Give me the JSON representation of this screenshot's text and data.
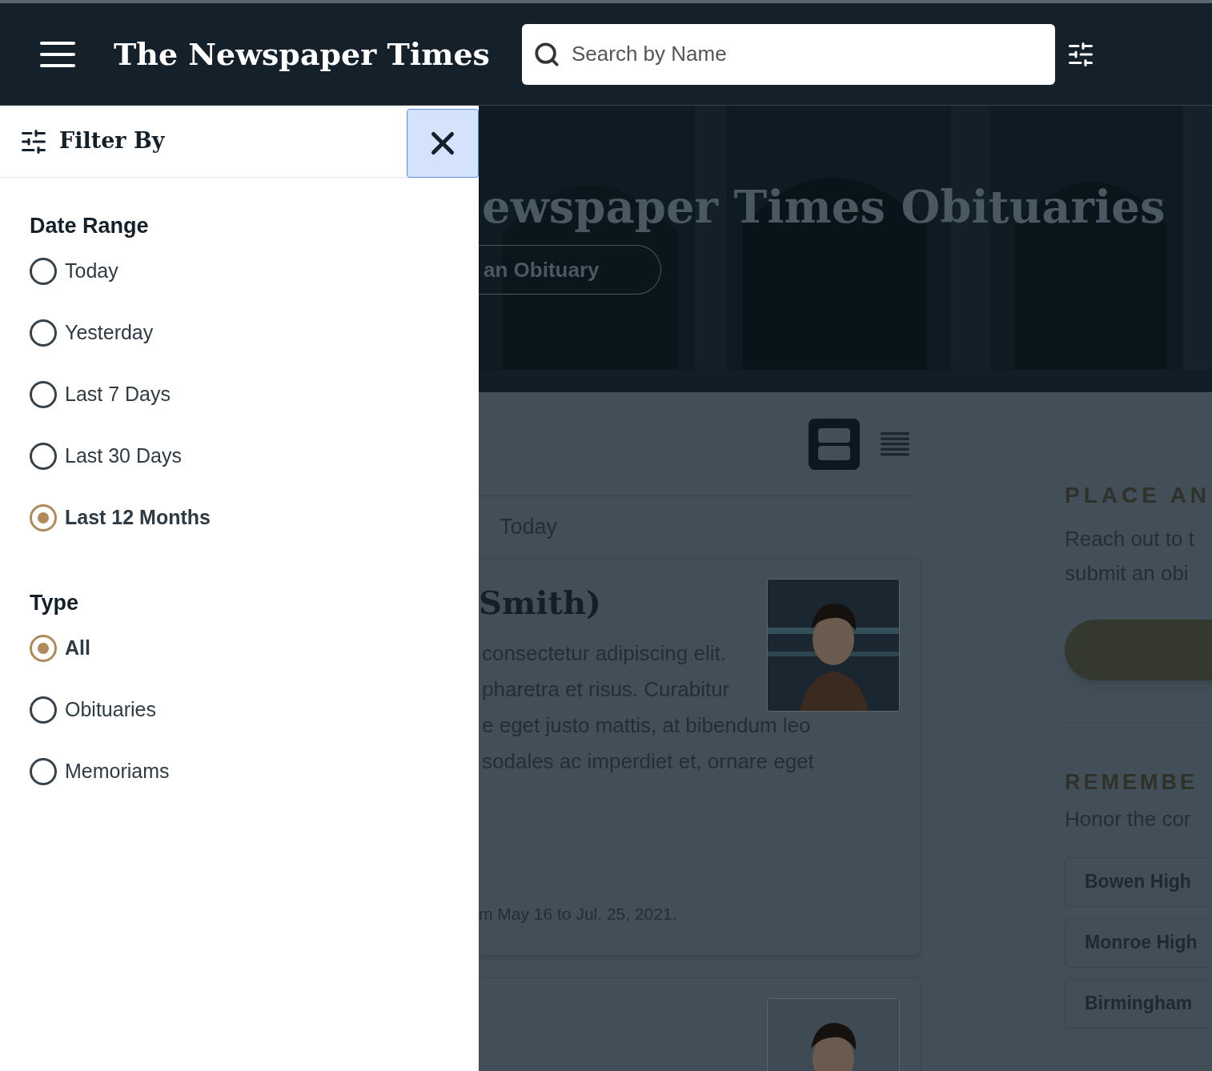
{
  "header": {
    "logo": "The Newspaper Times",
    "search": {
      "placeholder": "Search by Name"
    }
  },
  "filter_panel": {
    "title": "Filter By",
    "groups": [
      {
        "title": "Date Range",
        "options": [
          {
            "label": "Today",
            "selected": false
          },
          {
            "label": "Yesterday",
            "selected": false
          },
          {
            "label": "Last 7 Days",
            "selected": false
          },
          {
            "label": "Last 30 Days",
            "selected": false
          },
          {
            "label": "Last 12 Months",
            "selected": true
          }
        ]
      },
      {
        "title": "Type",
        "options": [
          {
            "label": "All",
            "selected": true
          },
          {
            "label": "Obituaries",
            "selected": false
          },
          {
            "label": "Memoriams",
            "selected": false
          }
        ]
      }
    ]
  },
  "hero": {
    "title": "ewspaper Times Obituaries",
    "button": "an Obituary"
  },
  "view_toggle": [
    {
      "kind": "cards",
      "selected": true
    },
    {
      "kind": "list",
      "selected": false
    }
  ],
  "listing": {
    "date_label": "Today",
    "cards": [
      {
        "name": "Smith)",
        "lines": [
          "consectetur adipiscing elit.",
          "pharetra et risus. Curabitur",
          "e eget justo mattis, at bibendum leo",
          "sodales ac imperdiet et, ornare eget"
        ],
        "footer": "m May 16 to Jul. 25, 2021."
      },
      {
        "kind": "photo-only"
      }
    ]
  },
  "sidebar": {
    "place": {
      "heading": "PLACE AN",
      "lines": [
        "Reach out to t",
        "submit an obi"
      ]
    },
    "remember": {
      "heading": "REMEMBE",
      "text": "Honor the cor",
      "schools": [
        "Bowen High",
        "Monroe High",
        "Birmingham"
      ]
    }
  }
}
